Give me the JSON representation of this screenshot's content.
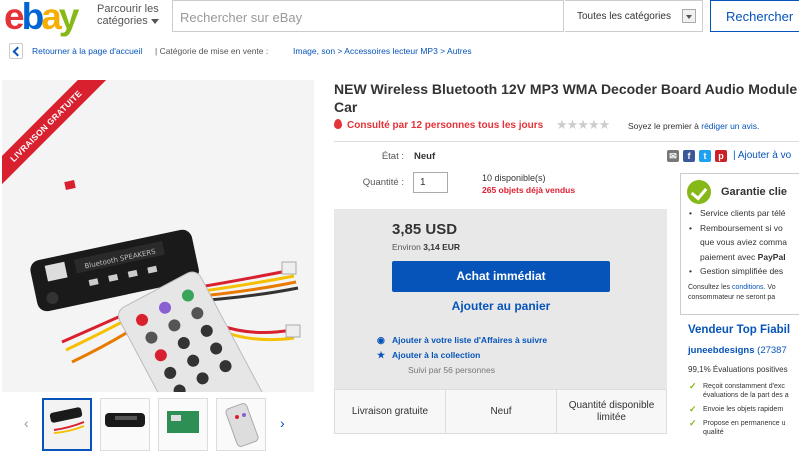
{
  "header": {
    "logo": {
      "e": "e",
      "b": "b",
      "a": "a",
      "y": "y"
    },
    "browse_line1": "Parcourir les",
    "browse_line2": "catégories",
    "search_placeholder": "Rechercher sur eBay",
    "category_select": "Toutes les catégories",
    "search_button": "Rechercher"
  },
  "breadcrumb": {
    "back": "Retourner à la page d'accueil",
    "listed_in": "| Catégorie de mise en vente :",
    "path": "Image, son  >  Accessoires lecteur MP3  >  Autres"
  },
  "gallery": {
    "ribbon": "LIVRAISON GRATUITE"
  },
  "listing": {
    "title": "NEW Wireless Bluetooth 12V MP3 WMA Decoder Board Audio Module Car",
    "hot": "Consulté par 12 personnes tous les jours",
    "stars": "★★★★★",
    "review_prefix": "Soyez le premier à",
    "review_link": "rédiger un avis."
  },
  "details": {
    "condition_label": "État :",
    "condition_value": "Neuf",
    "quantity_label": "Quantité :",
    "quantity_value": "1",
    "available": "10 disponible(s)",
    "sold": "265 objets déjà vendus"
  },
  "buy": {
    "price": "3,85 USD",
    "approx_prefix": "Environ",
    "approx_value": "3,14 EUR",
    "buy_now": "Achat immédiat",
    "add_cart": "Ajouter au panier",
    "watch": "Ajouter à votre liste d'Affaires à suivre",
    "collection": "Ajouter à la collection",
    "followed": "Suivi par 56 personnes"
  },
  "features": [
    "Livraison gratuite",
    "Neuf",
    "Quantité disponible limitée"
  ],
  "share": {
    "add_watch": "| Ajouter à vo"
  },
  "guarantee": {
    "title": "Garantie clie",
    "items": [
      "Service clients par télé",
      "Remboursement si vo",
      "que vous aviez comma",
      "paiement avec",
      "PayPal",
      "Gestion simplifiée des"
    ],
    "cond_line1_prefix": "Consultez les",
    "cond_link": "conditions.",
    "cond_line1_suffix": "Vo",
    "cond_line2": "consommateur ne seront pa"
  },
  "seller": {
    "badge": "Vendeur Top Fiabil",
    "name": "juneebdesigns",
    "score": "(27387",
    "positive": "99,1% Évaluations positives",
    "items": [
      "Reçoit constamment d'exc",
      "évaluations de la part des a",
      "Envoie les objets rapidem",
      "Propose en permanence u",
      "qualité"
    ]
  },
  "colors": {
    "accent": "#0654ba",
    "hot": "#e53238",
    "green": "#86b817"
  }
}
